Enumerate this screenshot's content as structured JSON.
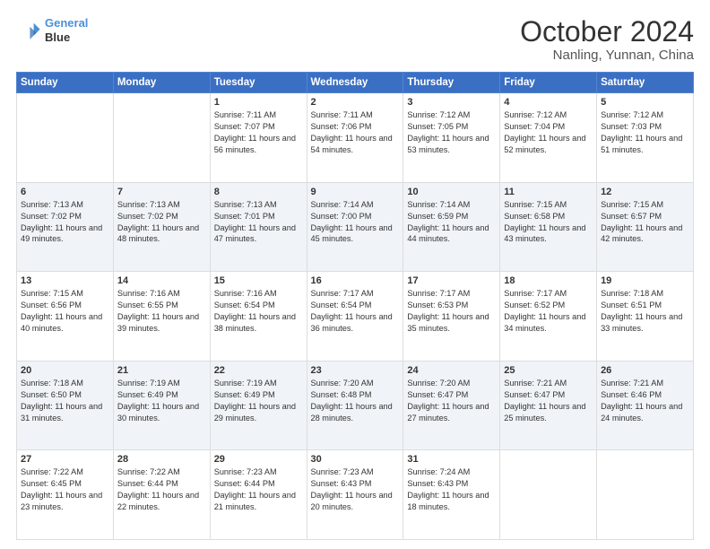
{
  "header": {
    "logo_line1": "General",
    "logo_line2": "Blue",
    "month": "October 2024",
    "location": "Nanling, Yunnan, China"
  },
  "weekdays": [
    "Sunday",
    "Monday",
    "Tuesday",
    "Wednesday",
    "Thursday",
    "Friday",
    "Saturday"
  ],
  "weeks": [
    [
      {
        "day": "",
        "info": ""
      },
      {
        "day": "",
        "info": ""
      },
      {
        "day": "1",
        "info": "Sunrise: 7:11 AM\nSunset: 7:07 PM\nDaylight: 11 hours and 56 minutes."
      },
      {
        "day": "2",
        "info": "Sunrise: 7:11 AM\nSunset: 7:06 PM\nDaylight: 11 hours and 54 minutes."
      },
      {
        "day": "3",
        "info": "Sunrise: 7:12 AM\nSunset: 7:05 PM\nDaylight: 11 hours and 53 minutes."
      },
      {
        "day": "4",
        "info": "Sunrise: 7:12 AM\nSunset: 7:04 PM\nDaylight: 11 hours and 52 minutes."
      },
      {
        "day": "5",
        "info": "Sunrise: 7:12 AM\nSunset: 7:03 PM\nDaylight: 11 hours and 51 minutes."
      }
    ],
    [
      {
        "day": "6",
        "info": "Sunrise: 7:13 AM\nSunset: 7:02 PM\nDaylight: 11 hours and 49 minutes."
      },
      {
        "day": "7",
        "info": "Sunrise: 7:13 AM\nSunset: 7:02 PM\nDaylight: 11 hours and 48 minutes."
      },
      {
        "day": "8",
        "info": "Sunrise: 7:13 AM\nSunset: 7:01 PM\nDaylight: 11 hours and 47 minutes."
      },
      {
        "day": "9",
        "info": "Sunrise: 7:14 AM\nSunset: 7:00 PM\nDaylight: 11 hours and 45 minutes."
      },
      {
        "day": "10",
        "info": "Sunrise: 7:14 AM\nSunset: 6:59 PM\nDaylight: 11 hours and 44 minutes."
      },
      {
        "day": "11",
        "info": "Sunrise: 7:15 AM\nSunset: 6:58 PM\nDaylight: 11 hours and 43 minutes."
      },
      {
        "day": "12",
        "info": "Sunrise: 7:15 AM\nSunset: 6:57 PM\nDaylight: 11 hours and 42 minutes."
      }
    ],
    [
      {
        "day": "13",
        "info": "Sunrise: 7:15 AM\nSunset: 6:56 PM\nDaylight: 11 hours and 40 minutes."
      },
      {
        "day": "14",
        "info": "Sunrise: 7:16 AM\nSunset: 6:55 PM\nDaylight: 11 hours and 39 minutes."
      },
      {
        "day": "15",
        "info": "Sunrise: 7:16 AM\nSunset: 6:54 PM\nDaylight: 11 hours and 38 minutes."
      },
      {
        "day": "16",
        "info": "Sunrise: 7:17 AM\nSunset: 6:54 PM\nDaylight: 11 hours and 36 minutes."
      },
      {
        "day": "17",
        "info": "Sunrise: 7:17 AM\nSunset: 6:53 PM\nDaylight: 11 hours and 35 minutes."
      },
      {
        "day": "18",
        "info": "Sunrise: 7:17 AM\nSunset: 6:52 PM\nDaylight: 11 hours and 34 minutes."
      },
      {
        "day": "19",
        "info": "Sunrise: 7:18 AM\nSunset: 6:51 PM\nDaylight: 11 hours and 33 minutes."
      }
    ],
    [
      {
        "day": "20",
        "info": "Sunrise: 7:18 AM\nSunset: 6:50 PM\nDaylight: 11 hours and 31 minutes."
      },
      {
        "day": "21",
        "info": "Sunrise: 7:19 AM\nSunset: 6:49 PM\nDaylight: 11 hours and 30 minutes."
      },
      {
        "day": "22",
        "info": "Sunrise: 7:19 AM\nSunset: 6:49 PM\nDaylight: 11 hours and 29 minutes."
      },
      {
        "day": "23",
        "info": "Sunrise: 7:20 AM\nSunset: 6:48 PM\nDaylight: 11 hours and 28 minutes."
      },
      {
        "day": "24",
        "info": "Sunrise: 7:20 AM\nSunset: 6:47 PM\nDaylight: 11 hours and 27 minutes."
      },
      {
        "day": "25",
        "info": "Sunrise: 7:21 AM\nSunset: 6:47 PM\nDaylight: 11 hours and 25 minutes."
      },
      {
        "day": "26",
        "info": "Sunrise: 7:21 AM\nSunset: 6:46 PM\nDaylight: 11 hours and 24 minutes."
      }
    ],
    [
      {
        "day": "27",
        "info": "Sunrise: 7:22 AM\nSunset: 6:45 PM\nDaylight: 11 hours and 23 minutes."
      },
      {
        "day": "28",
        "info": "Sunrise: 7:22 AM\nSunset: 6:44 PM\nDaylight: 11 hours and 22 minutes."
      },
      {
        "day": "29",
        "info": "Sunrise: 7:23 AM\nSunset: 6:44 PM\nDaylight: 11 hours and 21 minutes."
      },
      {
        "day": "30",
        "info": "Sunrise: 7:23 AM\nSunset: 6:43 PM\nDaylight: 11 hours and 20 minutes."
      },
      {
        "day": "31",
        "info": "Sunrise: 7:24 AM\nSunset: 6:43 PM\nDaylight: 11 hours and 18 minutes."
      },
      {
        "day": "",
        "info": ""
      },
      {
        "day": "",
        "info": ""
      }
    ]
  ]
}
